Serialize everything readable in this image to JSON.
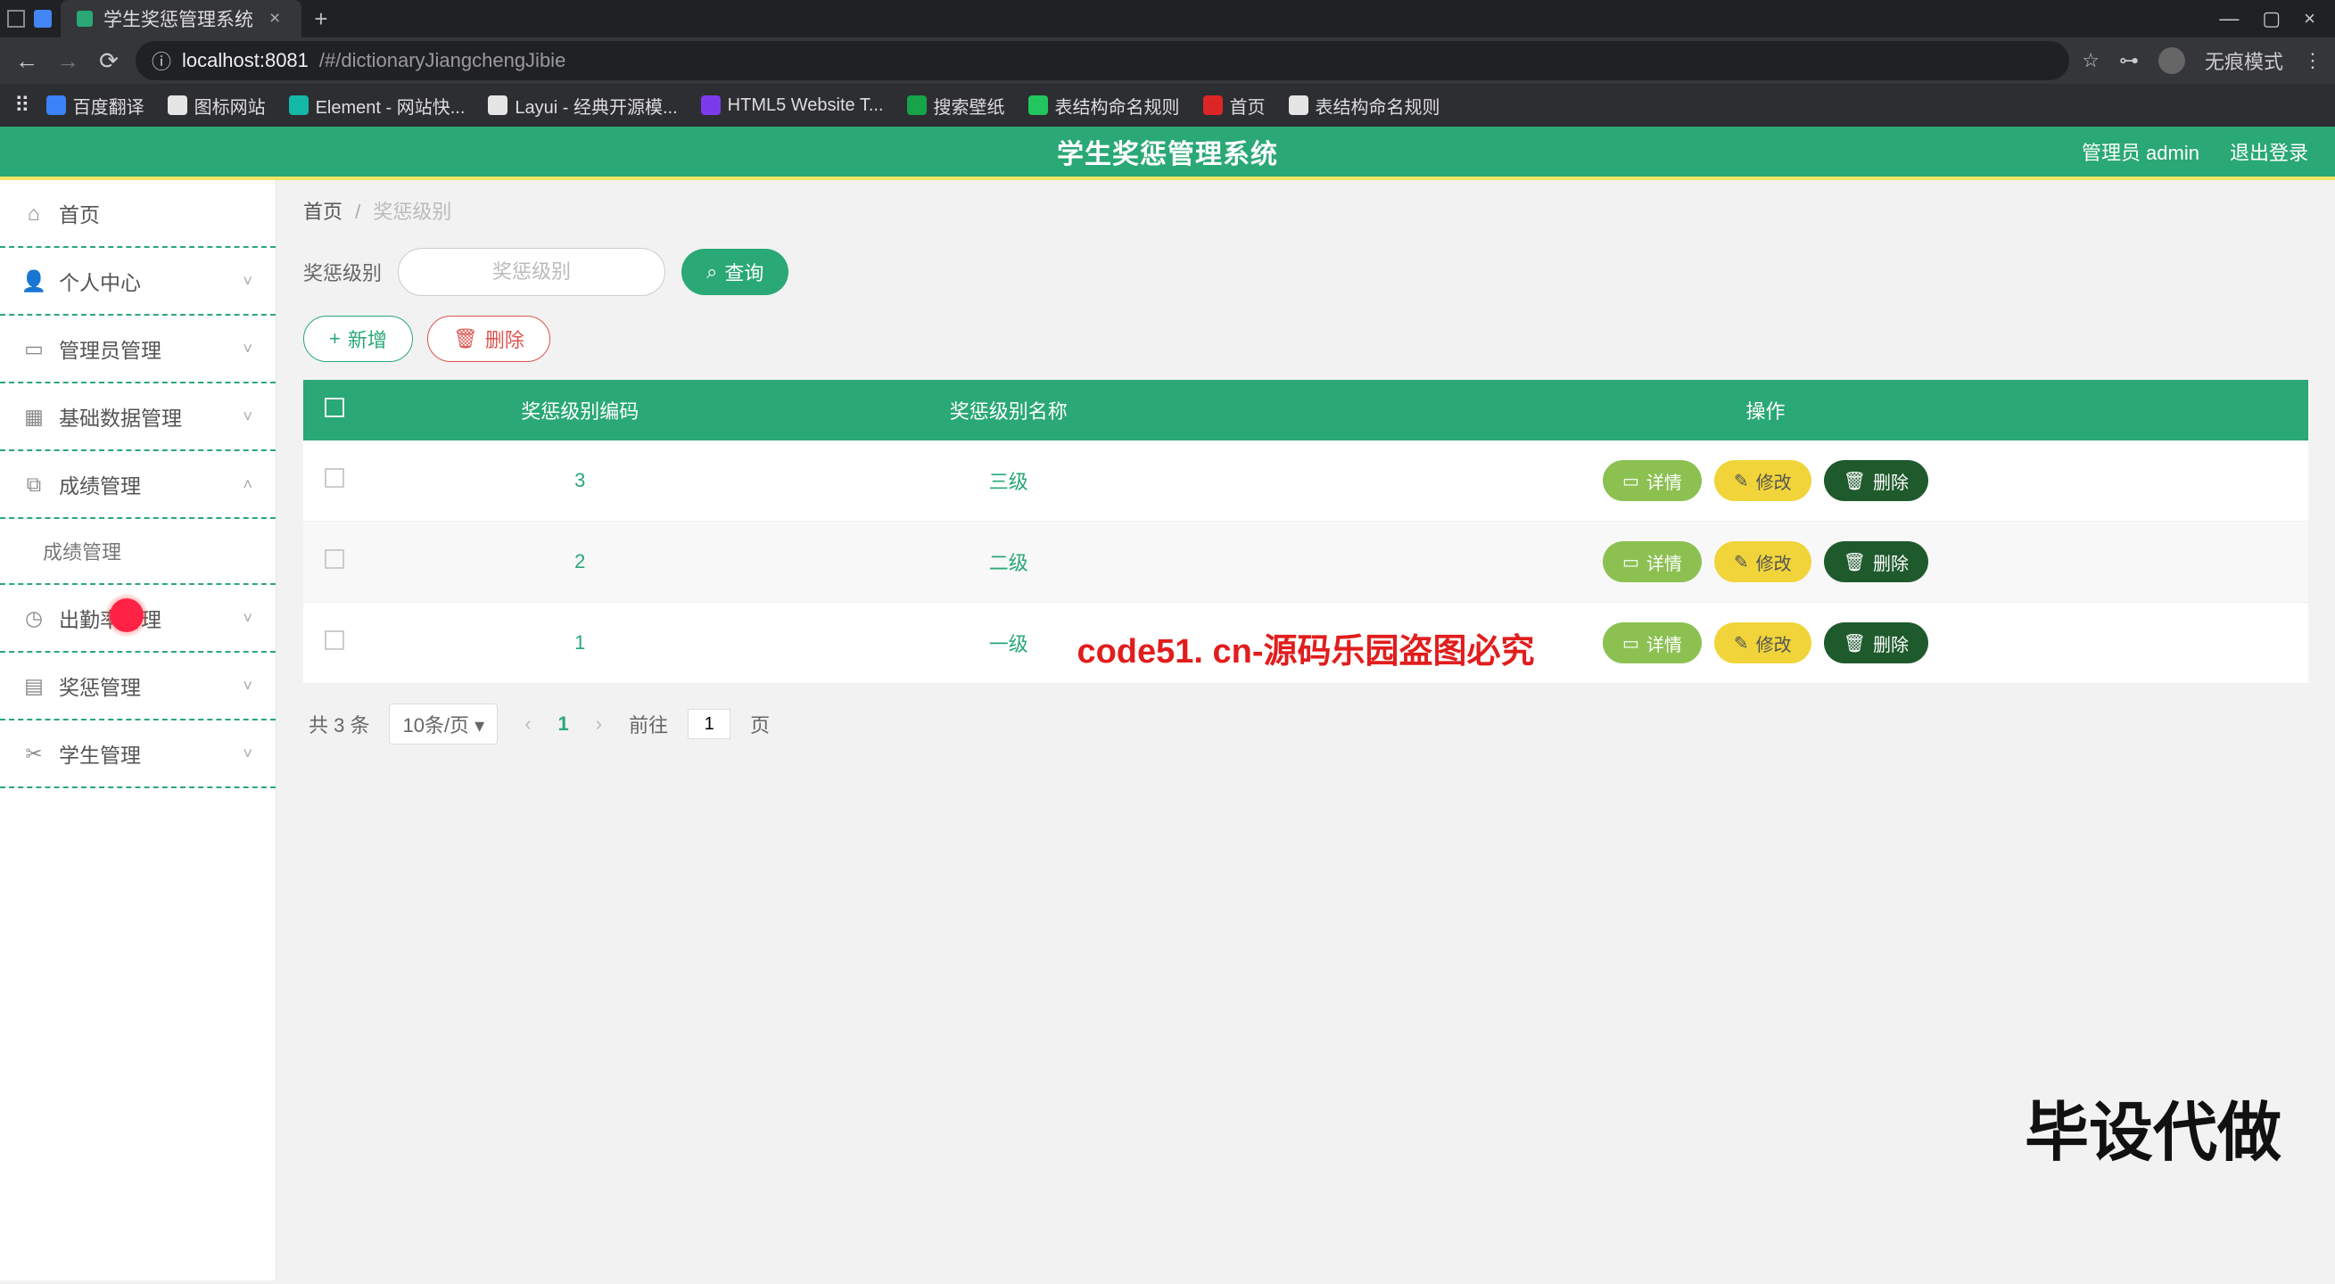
{
  "browser": {
    "tab_title": "学生奖惩管理系统",
    "url_host": "localhost:8081",
    "url_path": "/#/dictionaryJiangchengJibie",
    "incognito": "无痕模式",
    "bookmarks": [
      {
        "label": "百度翻译",
        "color": "blue"
      },
      {
        "label": "图标网站",
        "color": "white"
      },
      {
        "label": "Element - 网站快...",
        "color": "teal"
      },
      {
        "label": "Layui - 经典开源模...",
        "color": "white"
      },
      {
        "label": "HTML5 Website T...",
        "color": "purple"
      },
      {
        "label": "搜索壁纸",
        "color": "green"
      },
      {
        "label": "表结构命名规则",
        "color": "green2"
      },
      {
        "label": "首页",
        "color": "red"
      },
      {
        "label": "表结构命名规则",
        "color": "white"
      }
    ]
  },
  "header": {
    "title": "学生奖惩管理系统",
    "user_label": "管理员 admin",
    "logout": "退出登录"
  },
  "sidebar": {
    "items": [
      {
        "label": "首页",
        "icon": "home",
        "chev": false
      },
      {
        "label": "个人中心",
        "icon": "user",
        "chev": true
      },
      {
        "label": "管理员管理",
        "icon": "card",
        "chev": true
      },
      {
        "label": "基础数据管理",
        "icon": "grid",
        "chev": true
      },
      {
        "label": "成绩管理",
        "icon": "copy",
        "chev": true,
        "open": true
      },
      {
        "label": "成绩管理",
        "icon": "",
        "chev": false,
        "sub": true
      },
      {
        "label": "出勤率管理",
        "icon": "clock",
        "chev": true
      },
      {
        "label": "奖惩管理",
        "icon": "book",
        "chev": true
      },
      {
        "label": "学生管理",
        "icon": "crop",
        "chev": true
      }
    ]
  },
  "crumbs": {
    "home": "首页",
    "current": "奖惩级别"
  },
  "filter": {
    "label": "奖惩级别",
    "placeholder": "奖惩级别",
    "search": "查询",
    "add": "新增",
    "delete": "删除"
  },
  "table": {
    "columns": [
      "",
      "奖惩级别编码",
      "奖惩级别名称",
      "操作"
    ],
    "rows": [
      {
        "code": "3",
        "name": "三级"
      },
      {
        "code": "2",
        "name": "二级"
      },
      {
        "code": "1",
        "name": "一级"
      }
    ],
    "actions": {
      "view": "详情",
      "edit": "修改",
      "del": "删除"
    }
  },
  "pager": {
    "total": "共 3 条",
    "per": "10条/页",
    "page": "1",
    "goto": "前往",
    "goto_val": "1",
    "unit": "页"
  },
  "watermarks": {
    "red": "code51. cn-源码乐园盗图必究",
    "big": "毕设代做"
  }
}
